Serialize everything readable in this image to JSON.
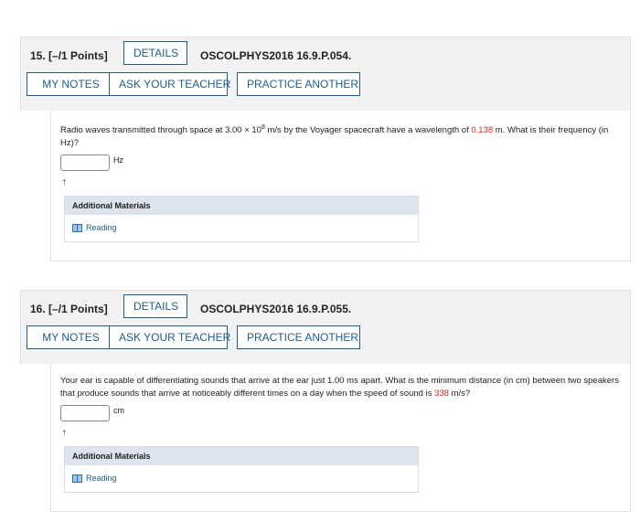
{
  "questions": [
    {
      "number": "15.",
      "points": "[–/1 Points]",
      "details_label": "DETAILS",
      "code": "OSCOLPHYS2016 16.9.P.054.",
      "my_notes_label": "MY NOTES",
      "ask_teacher_label": "ASK YOUR TEACHER",
      "practice_label": "PRACTICE ANOTHER",
      "text_before": "Radio waves transmitted through space at 3.00 × 10",
      "text_sup": "8",
      "text_mid": " m/s by the Voyager spacecraft have a wavelength of ",
      "text_red": "0.138",
      "text_after": " m. What is their frequency (in Hz)?",
      "answer_value": "",
      "unit": "Hz",
      "dagger": "†",
      "materials_title": "Additional Materials",
      "reading_label": "Reading"
    },
    {
      "number": "16.",
      "points": "[–/1 Points]",
      "details_label": "DETAILS",
      "code": "OSCOLPHYS2016 16.9.P.055.",
      "my_notes_label": "MY NOTES",
      "ask_teacher_label": "ASK YOUR TEACHER",
      "practice_label": "PRACTICE ANOTHER",
      "text_before": "Your ear is capable of differentiating sounds that arrive at the ear just 1.00 ms apart. What is the minimum distance (in cm) between two speakers that produce sounds that arrive at noticeably different times on a day when the speed of sound is ",
      "text_red": "338",
      "text_after": " m/s?",
      "answer_value": "",
      "unit": "cm",
      "dagger": "†",
      "materials_title": "Additional Materials",
      "reading_label": "Reading"
    }
  ],
  "colors": {
    "accent": "#1f5d8c",
    "highlight_red": "#d9271e",
    "header_bg": "#f2f2f2",
    "materials_head_bg": "#dde3ef"
  },
  "icons": {
    "reading": "book-icon"
  }
}
